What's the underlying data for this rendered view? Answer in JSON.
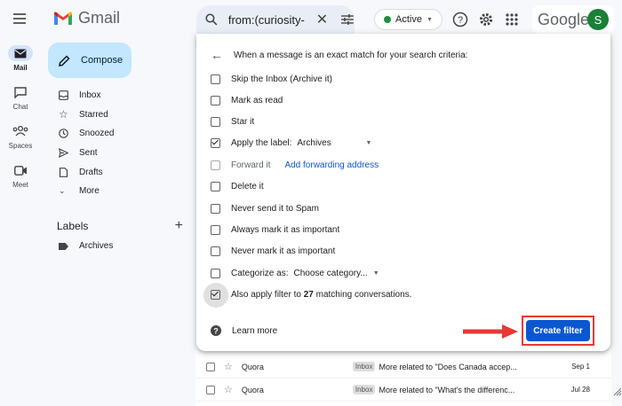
{
  "app": {
    "name": "Gmail",
    "google_label": "Google",
    "avatar_letter": "S"
  },
  "search": {
    "query": "from:(curiosity-"
  },
  "status": {
    "label": "Active",
    "color": "#1e8e3e"
  },
  "rail": [
    {
      "label": "Mail"
    },
    {
      "label": "Chat"
    },
    {
      "label": "Spaces"
    },
    {
      "label": "Meet"
    }
  ],
  "compose_label": "Compose",
  "nav": [
    {
      "label": "Inbox",
      "icon": "inbox-icon"
    },
    {
      "label": "Starred",
      "icon": "star-icon"
    },
    {
      "label": "Snoozed",
      "icon": "clock-icon"
    },
    {
      "label": "Sent",
      "icon": "send-icon"
    },
    {
      "label": "Drafts",
      "icon": "draft-icon"
    },
    {
      "label": "More",
      "icon": "chevron-down-icon"
    }
  ],
  "labels": {
    "heading": "Labels",
    "items": [
      {
        "label": "Archives"
      }
    ]
  },
  "dialog": {
    "header": "When a message is an exact match for your search criteria:",
    "options": {
      "skip_inbox": "Skip the Inbox (Archive it)",
      "mark_read": "Mark as read",
      "star_it": "Star it",
      "apply_label": "Apply the label:",
      "apply_label_value": "Archives",
      "forward_it": "Forward it",
      "add_forwarding": "Add forwarding address",
      "delete_it": "Delete it",
      "never_spam": "Never send it to Spam",
      "always_important": "Always mark it as important",
      "never_important": "Never mark it as important",
      "categorize_as": "Categorize as:",
      "categorize_value": "Choose category...",
      "also_apply_prefix": "Also apply filter to ",
      "also_apply_count": "27",
      "also_apply_suffix": " matching conversations."
    },
    "learn_more": "Learn more",
    "create_filter": "Create filter"
  },
  "emails": [
    {
      "sender": "Quora",
      "tag": "Inbox",
      "snippet": "More related to \"Does Canada accep...",
      "date": "Sep 1"
    },
    {
      "sender": "Quora",
      "tag": "Inbox",
      "snippet": "More related to \"What's the differenc...",
      "date": "Jul 28"
    }
  ],
  "colors": {
    "accent": "#0b57d0",
    "highlight_border": "#e53935",
    "compose_bg": "#c2e7ff"
  }
}
